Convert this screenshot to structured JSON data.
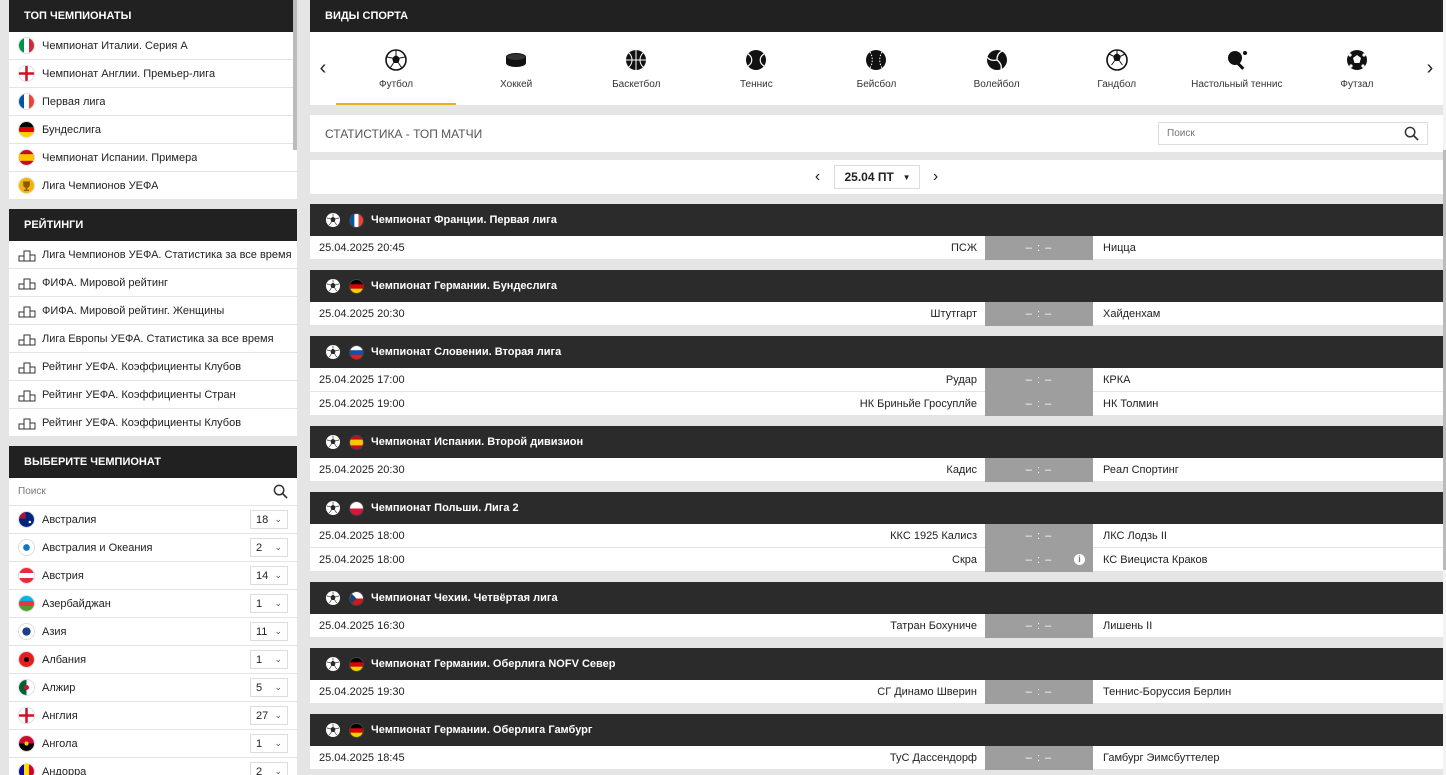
{
  "top": {
    "title": "ТОП ЧЕМПИОНАТЫ",
    "items": [
      {
        "label": "Чемпионат Италии. Серия А",
        "flag": "italy"
      },
      {
        "label": "Чемпионат Англии. Премьер-лига",
        "flag": "england"
      },
      {
        "label": "Первая лига",
        "flag": "france"
      },
      {
        "label": "Бундеслига",
        "flag": "germany"
      },
      {
        "label": "Чемпионат Испании. Примера",
        "flag": "spain"
      },
      {
        "label": "Лига Чемпионов УЕФА",
        "flag": "trophy"
      }
    ]
  },
  "ratings": {
    "title": "РЕЙТИНГИ",
    "items": [
      "Лига Чемпионов УЕФА. Статистика за все время",
      "ФИФА. Мировой рейтинг",
      "ФИФА. Мировой рейтинг. Женщины",
      "Лига Европы УЕФА. Статистика за все время",
      "Рейтинг УЕФА. Коэффициенты Клубов",
      "Рейтинг УЕФА. Коэффициенты Стран",
      "Рейтинг УЕФА. Коэффициенты Клубов"
    ]
  },
  "choose": {
    "title": "ВЫБЕРИТЕ ЧЕМПИОНАТ",
    "search_placeholder": "Поиск",
    "countries": [
      {
        "name": "Австралия",
        "count": "18",
        "flag": "australia"
      },
      {
        "name": "Австралия и Океания",
        "count": "2",
        "flag": "oceania"
      },
      {
        "name": "Австрия",
        "count": "14",
        "flag": "austria"
      },
      {
        "name": "Азербайджан",
        "count": "1",
        "flag": "azerbaijan"
      },
      {
        "name": "Азия",
        "count": "11",
        "flag": "asia"
      },
      {
        "name": "Албания",
        "count": "1",
        "flag": "albania"
      },
      {
        "name": "Алжир",
        "count": "5",
        "flag": "algeria"
      },
      {
        "name": "Англия",
        "count": "27",
        "flag": "england"
      },
      {
        "name": "Ангола",
        "count": "1",
        "flag": "angola"
      },
      {
        "name": "Андорра",
        "count": "2",
        "flag": "andorra"
      }
    ]
  },
  "sports": {
    "title": "ВИДЫ СПОРТА",
    "items": [
      {
        "label": "Футбол",
        "icon": "football-icon",
        "active": true
      },
      {
        "label": "Хоккей",
        "icon": "hockey-puck-icon"
      },
      {
        "label": "Баскетбол",
        "icon": "basketball-icon"
      },
      {
        "label": "Теннис",
        "icon": "tennis-ball-icon"
      },
      {
        "label": "Бейсбол",
        "icon": "baseball-icon"
      },
      {
        "label": "Волейбол",
        "icon": "volleyball-icon"
      },
      {
        "label": "Гандбол",
        "icon": "handball-icon"
      },
      {
        "label": "Настольный теннис",
        "icon": "table-tennis-icon"
      },
      {
        "label": "Футзал",
        "icon": "futsal-icon"
      }
    ]
  },
  "stats": {
    "title": "СТАТИСТИКА - ТОП МАТЧИ",
    "search_placeholder": "Поиск"
  },
  "date": {
    "value": "25.04 ПТ"
  },
  "leagues": [
    {
      "name": "Чемпионат Франции. Первая лига",
      "flag": "france",
      "matches": [
        {
          "time": "25.04.2025 20:45",
          "home": "ПСЖ",
          "score": "– : –",
          "away": "Ницца"
        }
      ]
    },
    {
      "name": "Чемпионат Германии. Бундеслига",
      "flag": "germany",
      "matches": [
        {
          "time": "25.04.2025 20:30",
          "home": "Штутгарт",
          "score": "– : –",
          "away": "Хайденхам"
        }
      ]
    },
    {
      "name": "Чемпионат Словении. Вторая лига",
      "flag": "slovenia",
      "matches": [
        {
          "time": "25.04.2025 17:00",
          "home": "Рудар",
          "score": "– : –",
          "away": "КРКА"
        },
        {
          "time": "25.04.2025 19:00",
          "home": "НК Бриньйе Гросуплйе",
          "score": "– : –",
          "away": "НК Толмин"
        }
      ]
    },
    {
      "name": "Чемпионат Испании. Второй дивизион",
      "flag": "spain",
      "matches": [
        {
          "time": "25.04.2025 20:30",
          "home": "Кадис",
          "score": "– : –",
          "away": "Реал Спортинг"
        }
      ]
    },
    {
      "name": "Чемпионат Польши. Лига 2",
      "flag": "poland",
      "matches": [
        {
          "time": "25.04.2025 18:00",
          "home": "ККС 1925 Калисз",
          "score": "– : –",
          "away": "ЛКС Лодзь II"
        },
        {
          "time": "25.04.2025 18:00",
          "home": "Скра",
          "score": "– : –",
          "away": "КС Виециста Краков",
          "info": true
        }
      ]
    },
    {
      "name": "Чемпионат Чехии. Четвёртая лига",
      "flag": "czech",
      "matches": [
        {
          "time": "25.04.2025 16:30",
          "home": "Татран Бохуниче",
          "score": "– : –",
          "away": "Лишень II"
        }
      ]
    },
    {
      "name": "Чемпионат Германии. Оберлига NOFV Север",
      "flag": "germany",
      "matches": [
        {
          "time": "25.04.2025 19:30",
          "home": "СГ Динамо Шверин",
          "score": "– : –",
          "away": "Теннис-Боруссия Берлин"
        }
      ]
    },
    {
      "name": "Чемпионат Германии. Оберлига Гамбург",
      "flag": "germany",
      "matches": [
        {
          "time": "25.04.2025 18:45",
          "home": "ТуС Дассендорф",
          "score": "– : –",
          "away": "Гамбург Эимсбуттелер"
        }
      ]
    }
  ],
  "colors": {
    "header": "#212121",
    "accent": "#e5b21b",
    "score_bg": "#9e9e9e",
    "page_bg": "#e5e5e5"
  }
}
